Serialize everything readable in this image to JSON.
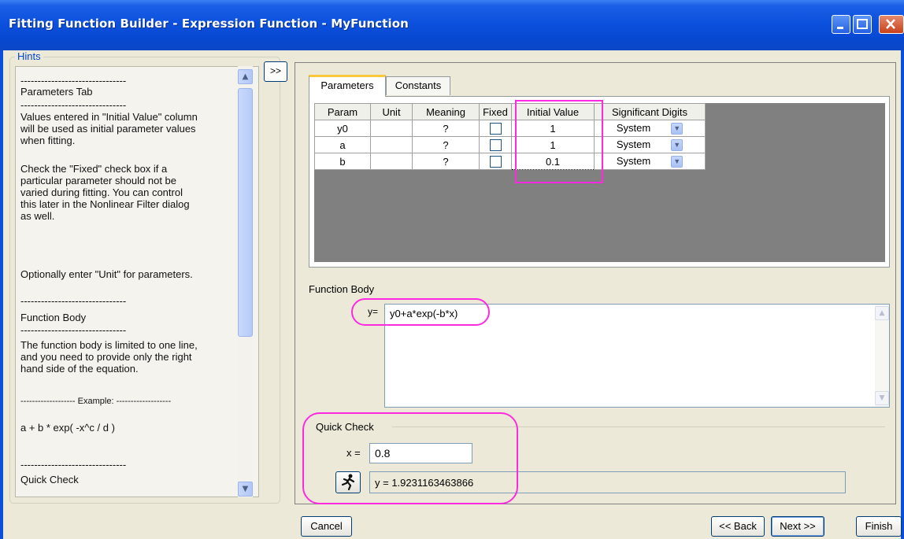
{
  "window": {
    "title": "Fitting Function Builder - Expression Function - MyFunction"
  },
  "hints": {
    "legend": "Hints",
    "lines": [
      "-------------------------------",
      "Parameters Tab",
      "-------------------------------",
      "Values entered in \"Initial Value\" column\nwill be used as initial parameter values\nwhen fitting.",
      "Check the \"Fixed\" check box if a\nparticular parameter should not be\nvaried during fitting. You can control\nthis later in the Nonlinear Filter dialog\nas well.",
      "Optionally enter \"Unit\" for parameters.",
      "-------------------------------",
      "Function Body",
      "-------------------------------",
      "The function body is limited to one line,\nand you need to provide only the right\nhand side of the equation.",
      "------------------- Example: -------------------",
      "a + b * exp( -x^c / d )",
      "-------------------------------",
      "Quick Check"
    ]
  },
  "expand_button": ">>",
  "tabs": [
    "Parameters",
    "Constants"
  ],
  "param_table": {
    "headers": [
      "Param",
      "Unit",
      "Meaning",
      "Fixed",
      "Initial Value",
      "Significant Digits"
    ],
    "rows": [
      {
        "param": "y0",
        "unit": "",
        "meaning": "?",
        "fixed": false,
        "initial": "1",
        "digits": "System"
      },
      {
        "param": "a",
        "unit": "",
        "meaning": "?",
        "fixed": false,
        "initial": "1",
        "digits": "System"
      },
      {
        "param": "b",
        "unit": "",
        "meaning": "?",
        "fixed": false,
        "initial": "0.1",
        "digits": "System"
      }
    ]
  },
  "function_body": {
    "label": "Function Body",
    "prefix": "y=",
    "value": "y0+a*exp(-b*x)"
  },
  "quick_check": {
    "legend": "Quick Check",
    "x_label": "x =",
    "x_value": "0.8",
    "result": "y = 1.9231163463866"
  },
  "buttons": {
    "cancel": "Cancel",
    "back": "<< Back",
    "next": "Next >>",
    "finish": "Finish"
  },
  "colors": {
    "titlebar": "#0a4fdc",
    "annotation": "#ff2adf",
    "dialog_bg": "#ece9d8"
  }
}
